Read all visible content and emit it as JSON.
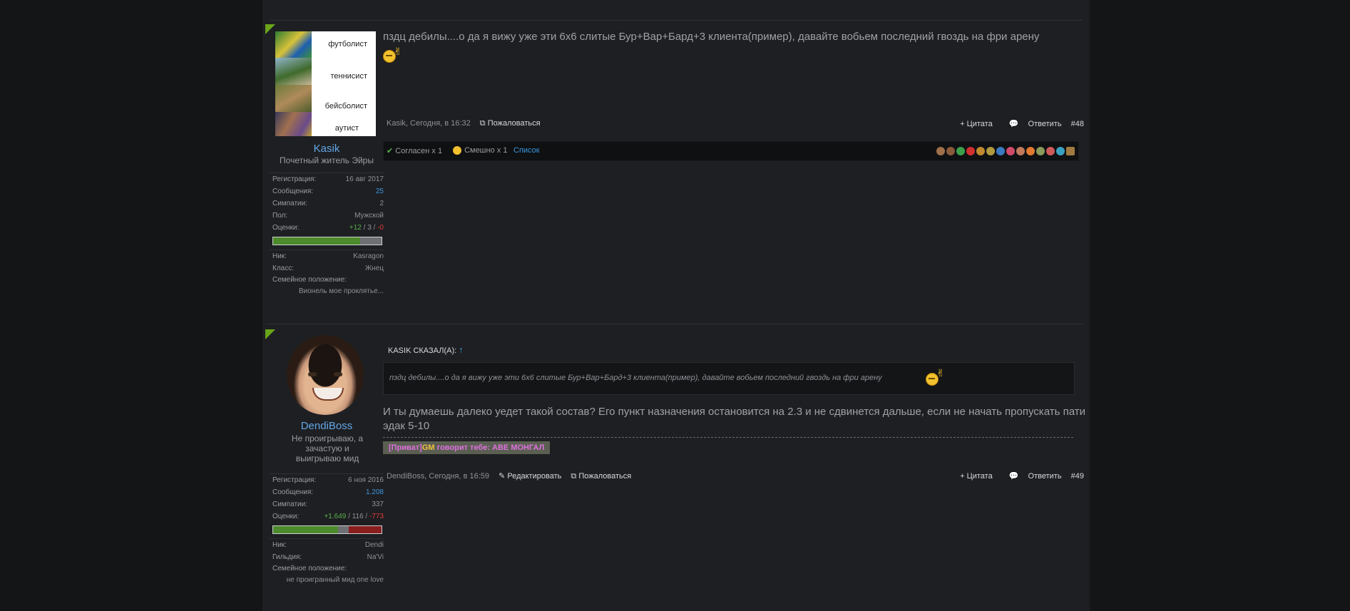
{
  "posts": [
    {
      "avatar_labels": [
        "футболист",
        "теннисист",
        "бейсболист",
        "аутист"
      ],
      "username": "Kasik",
      "user_title": "Почетный житель Эйры",
      "stats": [
        {
          "key": "Регистрация:",
          "value": "16 авг 2017"
        },
        {
          "key": "Сообщения:",
          "value": "25"
        },
        {
          "key": "Симпатии:",
          "value": "2"
        },
        {
          "key": "Пол:",
          "value": "Мужской"
        }
      ],
      "rating": {
        "label": "Оценки:",
        "plus": "+12",
        "neutral": "3",
        "minus": "-0",
        "sep": "/",
        "pos_fraction": 0.8,
        "neg_fraction": 0.0
      },
      "extra": [
        {
          "key": "Ник:",
          "value": "Kasragon"
        },
        {
          "key": "Класс:",
          "value": "Жнец"
        }
      ],
      "family_label": "Семейное положение:",
      "family_value": "Вионель мое проклятье...",
      "message": "пздц дебилы....о да я вижу уже эти 6х6 слитые Бур+Вар+Бард+3 клиента(пример), давайте вобьем последний гвоздь на фри арену",
      "author_time": "Kasik, Сегодня, в 16:32",
      "report": "Пожаловаться",
      "quote": "+ Цитата",
      "reply": "Ответить",
      "number": "#48",
      "likes": {
        "agree": "Согласен x 1",
        "funny": "Смешно x 1",
        "list": "Список"
      }
    },
    {
      "username": "DendiBoss",
      "user_title": "Не проигрываю, а зачастую и выигрываю мид",
      "stats": [
        {
          "key": "Регистрация:",
          "value": "6 ноя 2016"
        },
        {
          "key": "Сообщения:",
          "value": "1.208"
        },
        {
          "key": "Симпатии:",
          "value": "337"
        }
      ],
      "rating": {
        "label": "Оценки:",
        "plus": "+1.649",
        "neutral": "116",
        "minus": "-773",
        "sep": "/",
        "pos_fraction": 0.6,
        "neg_fraction": 0.3
      },
      "extra": [
        {
          "key": "Ник:",
          "value": "Dendi"
        },
        {
          "key": "Гильдия:",
          "value": "Na'Vi"
        }
      ],
      "family_label": "Семейное положение:",
      "family_value": "не проигранный мид one love",
      "quote_header": "KASIK СКАЗАЛ(А):",
      "quote_arrow": "↑",
      "quote_text": "пздц дебилы....о да я вижу уже эти 6х6 слитые Бур+Вар+Бард+3 клиента(пример), давайте вобьем последний гвоздь на фри арену",
      "message": "И ты думаешь далеко уедет такой состав? Его пункт назначения остановится на 2.3 и не сдвинется дальше, если не начать пропускать пати эдак 5-10",
      "signature": {
        "part1": "[Приват]",
        "part2": "GM",
        "part3": " говорит тебе: АВЕ МОНГАЛ"
      },
      "author_time": "DendiBoss, Сегодня, в 16:59",
      "edit": "Редактировать",
      "report": "Пожаловаться",
      "quote": "+ Цитата",
      "reply": "Ответить",
      "number": "#49"
    }
  ],
  "colors": {
    "accent": "#62a7e8",
    "corner": "#6aa61a",
    "positive": "#58b04a",
    "negative": "#e03a3a"
  },
  "icons": [
    "check-icon",
    "smile-icon",
    "report-icon",
    "reply-icon",
    "edit-icon",
    "pencil-icon"
  ]
}
